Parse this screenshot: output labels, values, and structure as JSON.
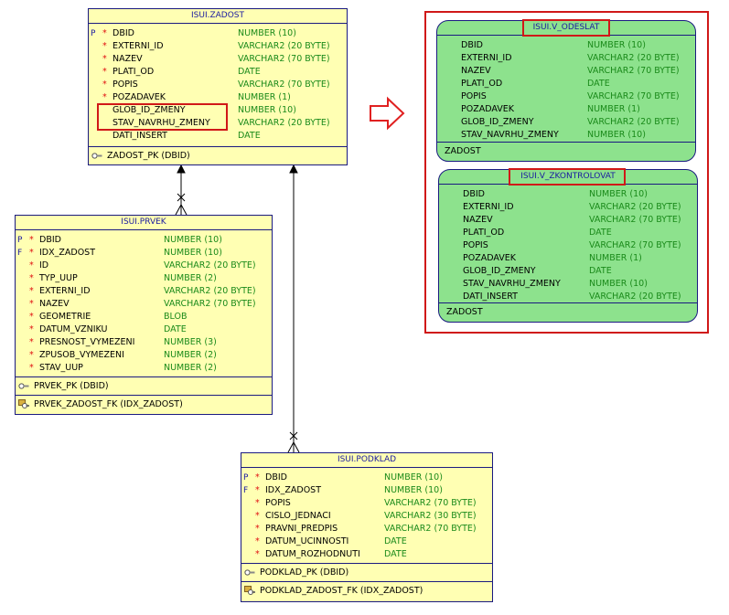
{
  "tables": {
    "zadost": {
      "title": "ISUI.ZADOST",
      "rows": [
        {
          "k": "P",
          "s": "*",
          "n": "DBID",
          "t": "NUMBER (10)"
        },
        {
          "k": "",
          "s": "*",
          "n": "EXTERNI_ID",
          "t": "VARCHAR2 (20 BYTE)"
        },
        {
          "k": "",
          "s": "*",
          "n": "NAZEV",
          "t": "VARCHAR2 (70 BYTE)"
        },
        {
          "k": "",
          "s": "*",
          "n": "PLATI_OD",
          "t": "DATE"
        },
        {
          "k": "",
          "s": "*",
          "n": "POPIS",
          "t": "VARCHAR2 (70 BYTE)"
        },
        {
          "k": "",
          "s": "*",
          "n": "POZADAVEK",
          "t": "NUMBER (1)"
        },
        {
          "k": "",
          "s": "",
          "n": "GLOB_ID_ZMENY",
          "t": "NUMBER (10)"
        },
        {
          "k": "",
          "s": "",
          "n": "STAV_NAVRHU_ZMENY",
          "t": "VARCHAR2 (20 BYTE)"
        },
        {
          "k": "",
          "s": "",
          "n": "DATI_INSERT",
          "t": "DATE"
        }
      ],
      "pk": "ZADOST_PK (DBID)"
    },
    "prvek": {
      "title": "ISUI.PRVEK",
      "rows": [
        {
          "k": "P",
          "s": "*",
          "n": "DBID",
          "t": "NUMBER (10)"
        },
        {
          "k": "F",
          "s": "*",
          "n": "IDX_ZADOST",
          "t": "NUMBER (10)"
        },
        {
          "k": "",
          "s": "*",
          "n": "ID",
          "t": "VARCHAR2 (20 BYTE)"
        },
        {
          "k": "",
          "s": "*",
          "n": "TYP_UUP",
          "t": "NUMBER (2)"
        },
        {
          "k": "",
          "s": "*",
          "n": "EXTERNI_ID",
          "t": "VARCHAR2 (20 BYTE)"
        },
        {
          "k": "",
          "s": "*",
          "n": "NAZEV",
          "t": "VARCHAR2 (70 BYTE)"
        },
        {
          "k": "",
          "s": "*",
          "n": "GEOMETRIE",
          "t": "BLOB"
        },
        {
          "k": "",
          "s": "*",
          "n": "DATUM_VZNIKU",
          "t": "DATE"
        },
        {
          "k": "",
          "s": "*",
          "n": "PRESNOST_VYMEZENI",
          "t": "NUMBER (3)"
        },
        {
          "k": "",
          "s": "*",
          "n": "ZPUSOB_VYMEZENI",
          "t": "NUMBER (2)"
        },
        {
          "k": "",
          "s": "*",
          "n": "STAV_UUP",
          "t": "NUMBER (2)"
        }
      ],
      "pk": "PRVEK_PK (DBID)",
      "fk": "PRVEK_ZADOST_FK (IDX_ZADOST)"
    },
    "podklad": {
      "title": "ISUI.PODKLAD",
      "rows": [
        {
          "k": "P",
          "s": "*",
          "n": "DBID",
          "t": "NUMBER (10)"
        },
        {
          "k": "F",
          "s": "*",
          "n": "IDX_ZADOST",
          "t": "NUMBER (10)"
        },
        {
          "k": "",
          "s": "*",
          "n": "POPIS",
          "t": "VARCHAR2 (70 BYTE)"
        },
        {
          "k": "",
          "s": "*",
          "n": "CISLO_JEDNACI",
          "t": "VARCHAR2 (30 BYTE)"
        },
        {
          "k": "",
          "s": "*",
          "n": "PRAVNI_PREDPIS",
          "t": "VARCHAR2 (70 BYTE)"
        },
        {
          "k": "",
          "s": "*",
          "n": "DATUM_UCINNOSTI",
          "t": "DATE"
        },
        {
          "k": "",
          "s": "*",
          "n": "DATUM_ROZHODNUTI",
          "t": "DATE"
        }
      ],
      "pk": "PODKLAD_PK (DBID)",
      "fk": "PODKLAD_ZADOST_FK (IDX_ZADOST)"
    }
  },
  "views": {
    "odeslat": {
      "title": "ISUI.V_ODESLAT",
      "rows": [
        {
          "n": "DBID",
          "t": "NUMBER (10)"
        },
        {
          "n": "EXTERNI_ID",
          "t": "VARCHAR2 (20 BYTE)"
        },
        {
          "n": "NAZEV",
          "t": "VARCHAR2 (70 BYTE)"
        },
        {
          "n": "PLATI_OD",
          "t": "DATE"
        },
        {
          "n": "POPIS",
          "t": "VARCHAR2 (70 BYTE)"
        },
        {
          "n": "POZADAVEK",
          "t": "NUMBER (1)"
        },
        {
          "n": "GLOB_ID_ZMENY",
          "t": "VARCHAR2 (20 BYTE)"
        },
        {
          "n": "STAV_NAVRHU_ZMENY",
          "t": "NUMBER (10)"
        }
      ],
      "footer": "ZADOST"
    },
    "zkontrolovat": {
      "title": "ISUI.V_ZKONTROLOVAT",
      "rows": [
        {
          "n": "DBID",
          "t": "NUMBER (10)"
        },
        {
          "n": "EXTERNI_ID",
          "t": "VARCHAR2 (20 BYTE)"
        },
        {
          "n": "NAZEV",
          "t": "VARCHAR2 (70 BYTE)"
        },
        {
          "n": "PLATI_OD",
          "t": "DATE"
        },
        {
          "n": "POPIS",
          "t": "VARCHAR2 (70 BYTE)"
        },
        {
          "n": "POZADAVEK",
          "t": "NUMBER (1)"
        },
        {
          "n": "GLOB_ID_ZMENY",
          "t": "DATE"
        },
        {
          "n": "STAV_NAVRHU_ZMENY",
          "t": "NUMBER (10)"
        },
        {
          "n": "DATI_INSERT",
          "t": "VARCHAR2 (20 BYTE)"
        }
      ],
      "footer": "ZADOST"
    }
  },
  "colors": {
    "table_fill": "#ffffb3",
    "view_fill": "#8de28d",
    "highlight": "#d01818",
    "type_text": "#1a8a1a",
    "title_text": "#1a1aa0"
  }
}
